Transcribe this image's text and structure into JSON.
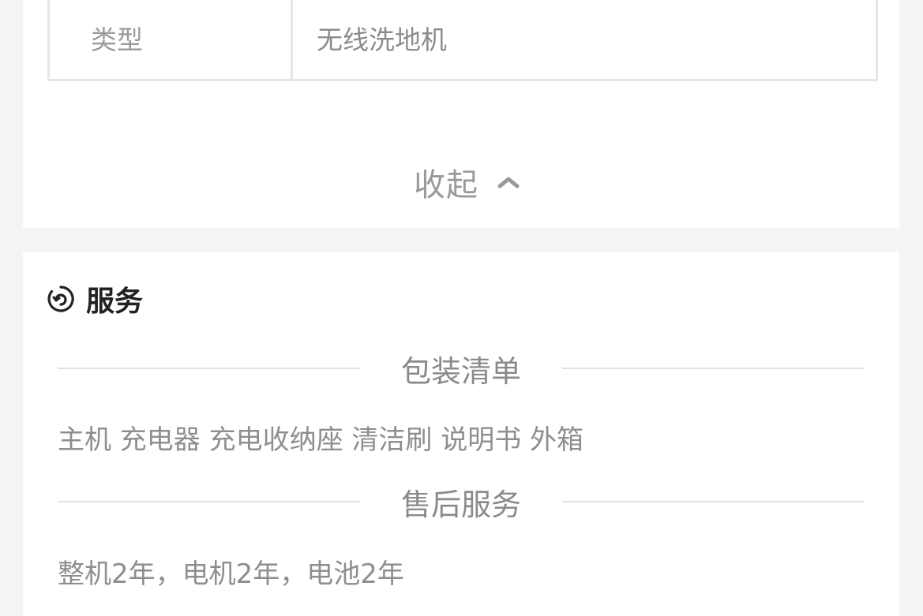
{
  "spec_table": {
    "rows": [
      {
        "key": "类型",
        "value": "无线洗地机"
      }
    ]
  },
  "collapse": {
    "label": "收起",
    "icon": "chevron-up-icon"
  },
  "service_section": {
    "icon": "service-refresh-icon",
    "title": "服务",
    "packing_list": {
      "heading": "包装清单",
      "content": "主机 充电器 充电收纳座 清洁刷 说明书 外箱"
    },
    "after_sales": {
      "heading": "售后服务",
      "content": "整机2年，电机2年，电池2年"
    }
  },
  "colors": {
    "page_bg": "#f4f4f4",
    "card_bg": "#ffffff",
    "border": "#e6e6e6",
    "muted_text": "#8e8e8e",
    "title_text": "#222222"
  }
}
